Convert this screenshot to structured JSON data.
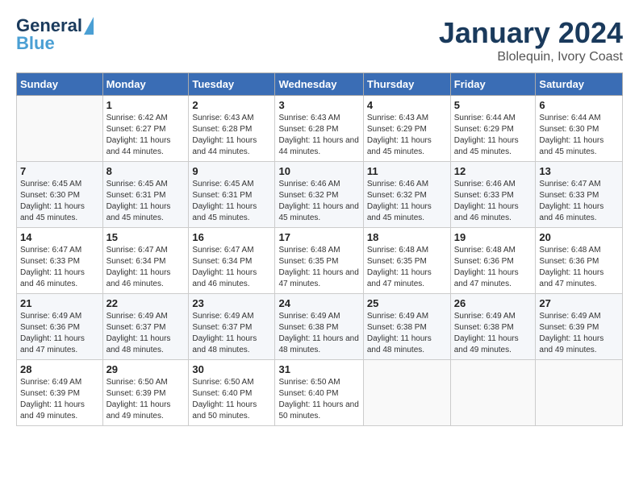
{
  "header": {
    "logo_line1": "General",
    "logo_line2": "Blue",
    "month_title": "January 2024",
    "subtitle": "Blolequin, Ivory Coast"
  },
  "days_of_week": [
    "Sunday",
    "Monday",
    "Tuesday",
    "Wednesday",
    "Thursday",
    "Friday",
    "Saturday"
  ],
  "weeks": [
    [
      {
        "day": null,
        "info": null
      },
      {
        "day": "1",
        "sunrise": "6:42 AM",
        "sunset": "6:27 PM",
        "daylight": "11 hours and 44 minutes."
      },
      {
        "day": "2",
        "sunrise": "6:43 AM",
        "sunset": "6:28 PM",
        "daylight": "11 hours and 44 minutes."
      },
      {
        "day": "3",
        "sunrise": "6:43 AM",
        "sunset": "6:28 PM",
        "daylight": "11 hours and 44 minutes."
      },
      {
        "day": "4",
        "sunrise": "6:43 AM",
        "sunset": "6:29 PM",
        "daylight": "11 hours and 45 minutes."
      },
      {
        "day": "5",
        "sunrise": "6:44 AM",
        "sunset": "6:29 PM",
        "daylight": "11 hours and 45 minutes."
      },
      {
        "day": "6",
        "sunrise": "6:44 AM",
        "sunset": "6:30 PM",
        "daylight": "11 hours and 45 minutes."
      }
    ],
    [
      {
        "day": "7",
        "sunrise": "6:45 AM",
        "sunset": "6:30 PM",
        "daylight": "11 hours and 45 minutes."
      },
      {
        "day": "8",
        "sunrise": "6:45 AM",
        "sunset": "6:31 PM",
        "daylight": "11 hours and 45 minutes."
      },
      {
        "day": "9",
        "sunrise": "6:45 AM",
        "sunset": "6:31 PM",
        "daylight": "11 hours and 45 minutes."
      },
      {
        "day": "10",
        "sunrise": "6:46 AM",
        "sunset": "6:32 PM",
        "daylight": "11 hours and 45 minutes."
      },
      {
        "day": "11",
        "sunrise": "6:46 AM",
        "sunset": "6:32 PM",
        "daylight": "11 hours and 45 minutes."
      },
      {
        "day": "12",
        "sunrise": "6:46 AM",
        "sunset": "6:33 PM",
        "daylight": "11 hours and 46 minutes."
      },
      {
        "day": "13",
        "sunrise": "6:47 AM",
        "sunset": "6:33 PM",
        "daylight": "11 hours and 46 minutes."
      }
    ],
    [
      {
        "day": "14",
        "sunrise": "6:47 AM",
        "sunset": "6:33 PM",
        "daylight": "11 hours and 46 minutes."
      },
      {
        "day": "15",
        "sunrise": "6:47 AM",
        "sunset": "6:34 PM",
        "daylight": "11 hours and 46 minutes."
      },
      {
        "day": "16",
        "sunrise": "6:47 AM",
        "sunset": "6:34 PM",
        "daylight": "11 hours and 46 minutes."
      },
      {
        "day": "17",
        "sunrise": "6:48 AM",
        "sunset": "6:35 PM",
        "daylight": "11 hours and 47 minutes."
      },
      {
        "day": "18",
        "sunrise": "6:48 AM",
        "sunset": "6:35 PM",
        "daylight": "11 hours and 47 minutes."
      },
      {
        "day": "19",
        "sunrise": "6:48 AM",
        "sunset": "6:36 PM",
        "daylight": "11 hours and 47 minutes."
      },
      {
        "day": "20",
        "sunrise": "6:48 AM",
        "sunset": "6:36 PM",
        "daylight": "11 hours and 47 minutes."
      }
    ],
    [
      {
        "day": "21",
        "sunrise": "6:49 AM",
        "sunset": "6:36 PM",
        "daylight": "11 hours and 47 minutes."
      },
      {
        "day": "22",
        "sunrise": "6:49 AM",
        "sunset": "6:37 PM",
        "daylight": "11 hours and 48 minutes."
      },
      {
        "day": "23",
        "sunrise": "6:49 AM",
        "sunset": "6:37 PM",
        "daylight": "11 hours and 48 minutes."
      },
      {
        "day": "24",
        "sunrise": "6:49 AM",
        "sunset": "6:38 PM",
        "daylight": "11 hours and 48 minutes."
      },
      {
        "day": "25",
        "sunrise": "6:49 AM",
        "sunset": "6:38 PM",
        "daylight": "11 hours and 48 minutes."
      },
      {
        "day": "26",
        "sunrise": "6:49 AM",
        "sunset": "6:38 PM",
        "daylight": "11 hours and 49 minutes."
      },
      {
        "day": "27",
        "sunrise": "6:49 AM",
        "sunset": "6:39 PM",
        "daylight": "11 hours and 49 minutes."
      }
    ],
    [
      {
        "day": "28",
        "sunrise": "6:49 AM",
        "sunset": "6:39 PM",
        "daylight": "11 hours and 49 minutes."
      },
      {
        "day": "29",
        "sunrise": "6:50 AM",
        "sunset": "6:39 PM",
        "daylight": "11 hours and 49 minutes."
      },
      {
        "day": "30",
        "sunrise": "6:50 AM",
        "sunset": "6:40 PM",
        "daylight": "11 hours and 50 minutes."
      },
      {
        "day": "31",
        "sunrise": "6:50 AM",
        "sunset": "6:40 PM",
        "daylight": "11 hours and 50 minutes."
      },
      {
        "day": null,
        "info": null
      },
      {
        "day": null,
        "info": null
      },
      {
        "day": null,
        "info": null
      }
    ]
  ],
  "labels": {
    "sunrise": "Sunrise:",
    "sunset": "Sunset:",
    "daylight": "Daylight:"
  }
}
